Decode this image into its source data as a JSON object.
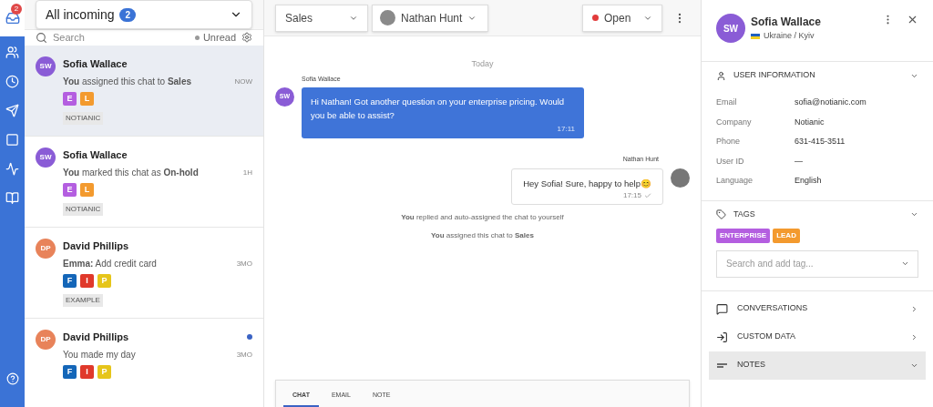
{
  "rail": {
    "badge": "2"
  },
  "inbox": {
    "title": "All incoming",
    "count": "2",
    "search_placeholder": "Search",
    "filter": "Unread"
  },
  "conversations": [
    {
      "initials": "SW",
      "color": "#8a5cd6",
      "name": "Sofia Wallace",
      "preview": "**You** assigned this chat to **Sales**",
      "time": "NOW",
      "selected": true,
      "unread": false,
      "tags": [
        {
          "letter": "E",
          "color": "#b45ee0"
        },
        {
          "letter": "L",
          "color": "#f39a2e"
        }
      ],
      "label": "NOTIANIC"
    },
    {
      "initials": "SW",
      "color": "#8a5cd6",
      "name": "Sofia Wallace",
      "preview": "**You** marked this chat as **On-hold**",
      "time": "1H",
      "selected": false,
      "unread": false,
      "tags": [
        {
          "letter": "E",
          "color": "#b45ee0"
        },
        {
          "letter": "L",
          "color": "#f39a2e"
        }
      ],
      "label": "NOTIANIC"
    },
    {
      "initials": "DP",
      "color": "#e8835a",
      "name": "David Phillips",
      "preview": "**Emma:** Add credit card",
      "time": "3MO",
      "selected": false,
      "unread": false,
      "tags": [
        {
          "letter": "F",
          "color": "#1466b8"
        },
        {
          "letter": "I",
          "color": "#e0392b"
        },
        {
          "letter": "P",
          "color": "#e6c51a"
        }
      ],
      "label": "EXAMPLE"
    },
    {
      "initials": "DP",
      "color": "#e8835a",
      "name": "David Phillips",
      "preview": "You made my day",
      "time": "3MO",
      "selected": false,
      "unread": true,
      "tags": [
        {
          "letter": "F",
          "color": "#1466b8"
        },
        {
          "letter": "I",
          "color": "#e0392b"
        },
        {
          "letter": "P",
          "color": "#e6c51a"
        }
      ]
    }
  ],
  "chat_header": {
    "team": "Sales",
    "agent": "Nathan Hunt",
    "status": "Open"
  },
  "messages": [
    {
      "kind": "divider",
      "text": "Today"
    },
    {
      "kind": "incoming",
      "author": "Sofia Wallace",
      "initials": "SW",
      "text": "Hi Nathan! Got another question on your enterprise pricing. Would you be able to assist?",
      "time": "17:11"
    },
    {
      "kind": "outgoing",
      "author": "Nathan Hunt",
      "text": "Hey Sofia! Sure, happy to help😊",
      "time": "17:15"
    },
    {
      "kind": "system",
      "text": "**You** replied and auto-assigned the chat to yourself"
    },
    {
      "kind": "system",
      "text": "**You** assigned this chat to **Sales**"
    }
  ],
  "composer_tabs": [
    {
      "label": "CHAT",
      "selected": true
    },
    {
      "label": "EMAIL",
      "selected": false
    },
    {
      "label": "NOTE",
      "selected": false
    }
  ],
  "contact": {
    "initials": "SW",
    "name": "Sofia Wallace",
    "location": "Ukraine / Kyiv",
    "user_information": {
      "title": "USER INFORMATION",
      "fields": [
        {
          "label": "Email",
          "value": "sofia@notianic.com"
        },
        {
          "label": "Company",
          "value": "Notianic"
        },
        {
          "label": "Phone",
          "value": "631-415-3511"
        },
        {
          "label": "User ID",
          "value": "—"
        },
        {
          "label": "Language",
          "value": "English"
        }
      ]
    },
    "tags": {
      "title": "TAGS",
      "items": [
        {
          "label": "ENTERPRISE",
          "color": "#b45ee0"
        },
        {
          "label": "LEAD",
          "color": "#f39a2e"
        }
      ],
      "placeholder": "Search and add tag..."
    },
    "sections": [
      {
        "title": "CONVERSATIONS",
        "expanded": false,
        "selected": false
      },
      {
        "title": "CUSTOM DATA",
        "expanded": false,
        "selected": false
      },
      {
        "title": "NOTES",
        "expanded": true,
        "selected": true
      }
    ]
  }
}
